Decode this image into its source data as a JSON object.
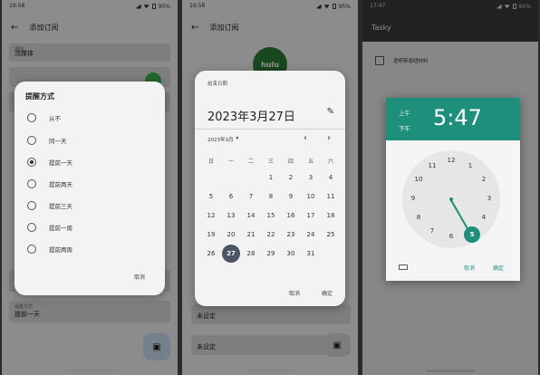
{
  "panel1": {
    "status": {
      "time": "16:58",
      "battery": "95%"
    },
    "title": "添加订阅",
    "fields": [
      {
        "label": "类别",
        "value": "流媒体"
      },
      {
        "label": "提醒方式",
        "value": "提前一天"
      }
    ],
    "dialog": {
      "title": "提醒方式",
      "options": [
        "从不",
        "同一天",
        "提前一天",
        "提前两天",
        "提前三天",
        "提前一周",
        "提前两周"
      ],
      "selected_index": 2,
      "cancel": "取消"
    }
  },
  "panel2": {
    "status": {
      "time": "16:58",
      "battery": "95%"
    },
    "title": "添加订阅",
    "logo": "hulu",
    "fields": [
      {
        "label": "",
        "value": "未设定"
      },
      {
        "label": "",
        "value": "未设定"
      }
    ],
    "dialog": {
      "header": "结束日期",
      "date": "2023年3月27日",
      "month": "2023年3月",
      "weekdays": [
        "日",
        "一",
        "二",
        "三",
        "四",
        "五",
        "六"
      ],
      "weeks": [
        [
          "",
          "",
          "",
          "1",
          "2",
          "3",
          "4"
        ],
        [
          "5",
          "6",
          "7",
          "8",
          "9",
          "10",
          "11"
        ],
        [
          "12",
          "13",
          "14",
          "15",
          "16",
          "17",
          "18"
        ],
        [
          "19",
          "20",
          "21",
          "22",
          "23",
          "24",
          "25"
        ],
        [
          "26",
          "27",
          "28",
          "29",
          "30",
          "31",
          ""
        ]
      ],
      "selected_day": "27",
      "cancel": "取消",
      "ok": "确定"
    }
  },
  "panel3": {
    "status": {
      "time": "17:47",
      "battery": "95%"
    },
    "title": "Tasky",
    "checkbox_label": "透明带患纽材料",
    "dialog": {
      "am": "上午",
      "pm": "下午",
      "time": "5:47",
      "numbers": [
        "12",
        "1",
        "2",
        "3",
        "4",
        "5",
        "6",
        "7",
        "8",
        "9",
        "10",
        "11"
      ],
      "selected": "5",
      "cancel": "取消",
      "ok": "确定"
    }
  },
  "colors": {
    "accent_teal": "#1e8f7a",
    "dark_ink": "#4b5563"
  },
  "icons": [
    "back-arrow-icon",
    "pencil-icon",
    "chevron-left-icon",
    "chevron-right-icon",
    "dropdown-icon",
    "keyboard-icon",
    "save-icon",
    "checkbox-icon"
  ]
}
